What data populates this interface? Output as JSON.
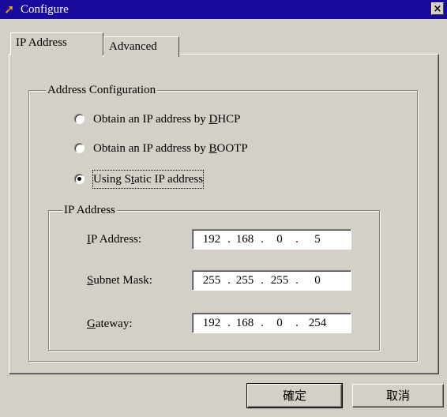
{
  "window": {
    "title": "Configure",
    "close_glyph": "×",
    "icon": "app-arrow-icon"
  },
  "tabs": [
    {
      "label": "IP Address",
      "active": true
    },
    {
      "label": "Advanced",
      "active": false
    }
  ],
  "address_config": {
    "legend": "Address Configuration",
    "options": [
      {
        "pre": "Obtain an IP address by ",
        "mnemonic": "D",
        "post": "HCP",
        "selected": false
      },
      {
        "pre": "Obtain an IP address by ",
        "mnemonic": "B",
        "post": "OOTP",
        "selected": false
      },
      {
        "pre": "Using S",
        "mnemonic": "t",
        "post": "atic IP address",
        "selected": true
      }
    ]
  },
  "ip_group": {
    "legend": "IP Address",
    "fields": [
      {
        "mnemonic": "I",
        "label_rest": "P Address:",
        "octets": [
          "192",
          "168",
          "0",
          "5"
        ]
      },
      {
        "mnemonic": "S",
        "label_rest": "ubnet Mask:",
        "octets": [
          "255",
          "255",
          "255",
          "0"
        ]
      },
      {
        "mnemonic": "G",
        "label_rest": "ateway:",
        "octets": [
          "192",
          "168",
          "0",
          "254"
        ]
      }
    ]
  },
  "buttons": {
    "ok": "確定",
    "cancel": "取消"
  },
  "colors": {
    "titlebar": "#1a0a9c",
    "face": "#d4d0c8"
  }
}
